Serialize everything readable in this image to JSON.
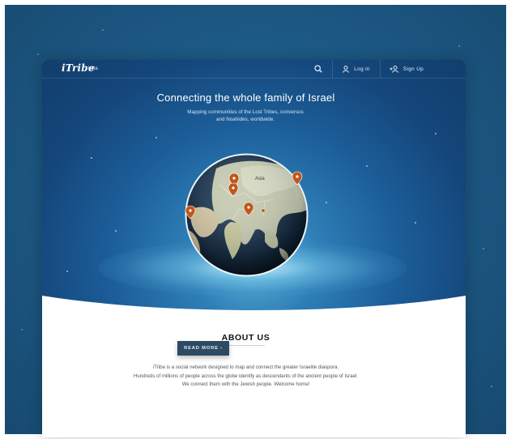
{
  "nav": {
    "logo": "iTribe",
    "badge": "beta",
    "login_label": "Log in",
    "signup_label": "Sign Up"
  },
  "hero": {
    "title": "Connecting the whole family of Israel",
    "subtitle_line1": "Mapping communities of the Lost Tribes, conversos",
    "subtitle_line2": "and Noahides, worldwide."
  },
  "globe": {
    "region_label": "Asia",
    "marker_color": "#c0561a"
  },
  "about": {
    "title": "ABOUT US",
    "line1": "iTribe is a social network designed to map and connect the greater Israelite diaspora.",
    "line2": "Hundreds of millions of people across the globe identify as descendants of the ancient people of Israel.",
    "line3": "We connect them with the Jewish people. Welcome home!",
    "button_label": "READ MORE ›"
  },
  "colors": {
    "hero_dark": "#113e6c",
    "hero_light": "#5fb3d8",
    "button_bg": "#2d4a63"
  }
}
